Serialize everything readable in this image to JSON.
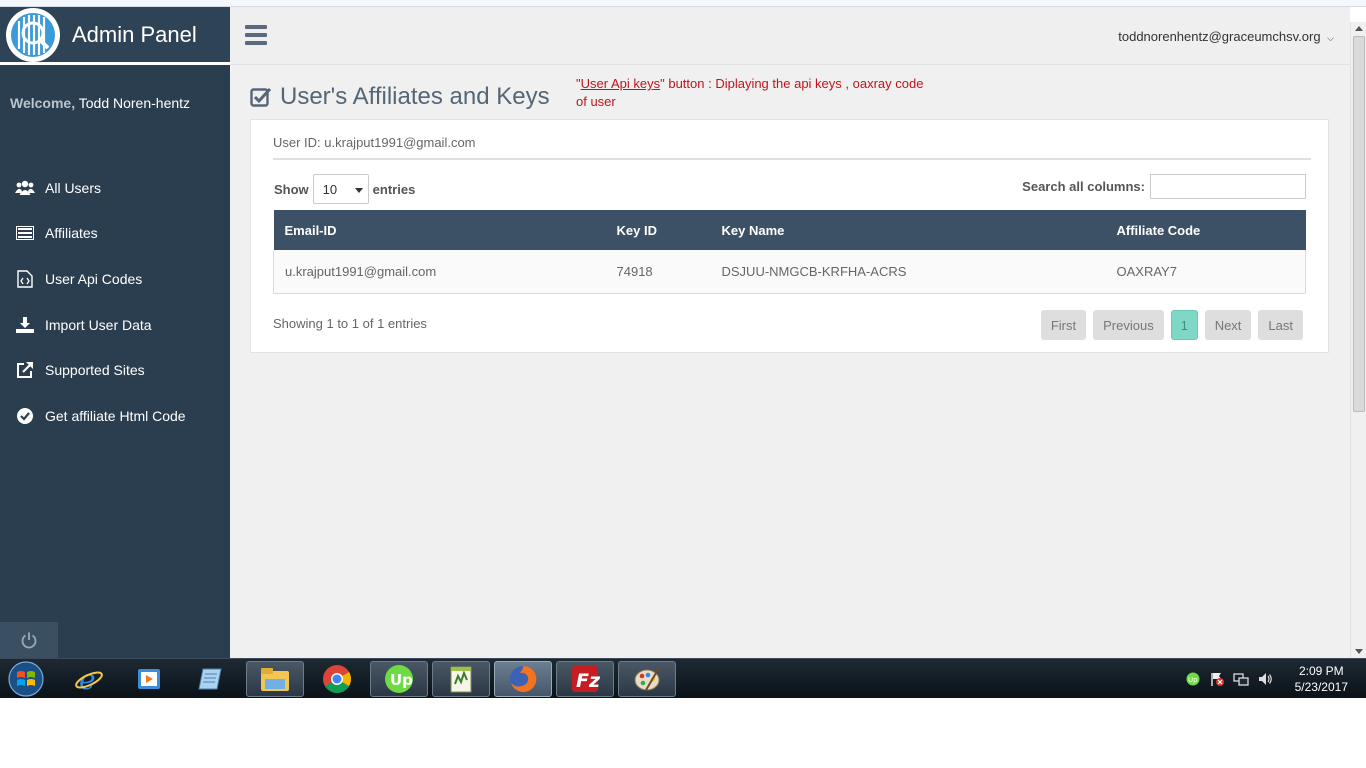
{
  "brand": {
    "title": "Admin Panel"
  },
  "sidebar": {
    "welcome_label": "Welcome,",
    "user_name": "Todd Noren-hentz",
    "items": [
      {
        "label": "All Users",
        "icon": "users-icon"
      },
      {
        "label": "Affiliates",
        "icon": "list-icon"
      },
      {
        "label": "User Api Codes",
        "icon": "code-file-icon"
      },
      {
        "label": "Import User Data",
        "icon": "download-icon"
      },
      {
        "label": "Supported Sites",
        "icon": "external-link-icon"
      },
      {
        "label": "Get affiliate Html Code",
        "icon": "check-circle-icon"
      }
    ]
  },
  "header": {
    "user_email": "toddnorenhentz@graceumchsv.org"
  },
  "page": {
    "title": "User's Affiliates and Keys",
    "annotation_quote_open": "\"",
    "annotation_link": "User Api keys",
    "annotation_rest": "\" button : Diplaying the api keys , oaxray code of user"
  },
  "panel": {
    "user_id": "User ID: u.krajput1991@gmail.com",
    "show_label": "Show",
    "entries_value": "10",
    "entries_label": "entries",
    "search_label": "Search all columns:",
    "search_value": ""
  },
  "table": {
    "columns": [
      "Email-ID",
      "Key ID",
      "Key Name",
      "Affiliate Code"
    ],
    "rows": [
      {
        "email": "u.krajput1991@gmail.com",
        "key_id": "74918",
        "key_name": "DSJUU-NMGCB-KRFHA-ACRS",
        "affiliate_code": "OAXRAY7"
      }
    ]
  },
  "footer": {
    "info": "Showing 1 to 1 of 1 entries",
    "pager": {
      "first": "First",
      "previous": "Previous",
      "current": "1",
      "next": "Next",
      "last": "Last"
    }
  },
  "taskbar": {
    "apps": [
      "internet-explorer-icon",
      "media-player-icon",
      "notepad-icon",
      "file-explorer-icon",
      "chrome-icon",
      "upwork-icon",
      "notepad-plus-icon",
      "firefox-icon",
      "filezilla-icon",
      "paint-icon"
    ],
    "clock_time": "2:09 PM",
    "clock_date": "5/23/2017"
  },
  "colors": {
    "sidebar_bg": "#2b3e50",
    "table_header_bg": "#3d5166",
    "active_page": "#7fd8c5",
    "annotation": "#c0141a"
  }
}
